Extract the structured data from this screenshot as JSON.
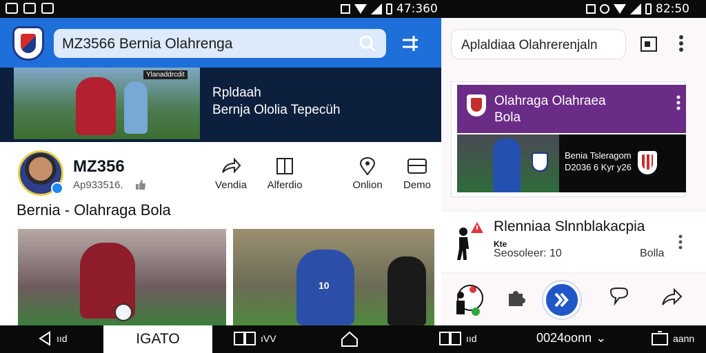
{
  "status_bar": {
    "left_time": "47:360",
    "right_time": "82:50"
  },
  "left_app": {
    "search": {
      "value": "MZ3566 Bernia Olahrenga"
    },
    "banner": {
      "tag": "Ylanaddrcdit",
      "title_line1": "Rpldaah",
      "title_line2": "Bernja Ololia Tepecüh"
    },
    "profile": {
      "name": "MZ356",
      "subtitle": "Ap933516.",
      "post_title": "Bernia - Olahraga Bola",
      "actions": [
        {
          "label": "Vendia",
          "icon": "share-icon"
        },
        {
          "label": "Alferdio",
          "icon": "bookmark-icon"
        },
        {
          "label": "Onlion",
          "icon": "location-icon"
        },
        {
          "label": "Demo",
          "icon": "card-icon"
        }
      ],
      "photo_numbers": {
        "p2_number": "10"
      }
    }
  },
  "right_app": {
    "search": {
      "value": "Aplaldiaa Olahrerenjaln"
    },
    "panel": {
      "title_line1": "Olahraga Olahraea",
      "title_line2": "Bola",
      "video_line1": "Benia Tsleragom",
      "video_line2": "D2036 6 Kyr y26"
    },
    "list_item": {
      "title": "Rlenniaa Slnnblakacpia",
      "sub1": "Kte",
      "sub2": "Seosoleer: 10",
      "meta": "Bolla"
    }
  },
  "nav_bar": {
    "left_label": "ııd",
    "active_tab": "IGATO",
    "center_label": "ıVV",
    "right_label1": "ııd",
    "right_label2": "0024oonn",
    "right_label3": "aann"
  },
  "colors": {
    "top_bar_blue": "#1e6fd9",
    "banner_navy": "#0c1f3d",
    "panel_purple": "#6a2c86",
    "play_blue": "#1f57c8"
  }
}
